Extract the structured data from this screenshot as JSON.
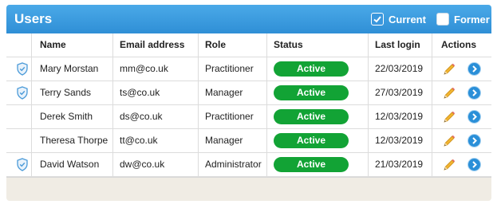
{
  "header": {
    "title": "Users",
    "filters": [
      {
        "label": "Current",
        "checked": true
      },
      {
        "label": "Former",
        "checked": false
      }
    ]
  },
  "columns": [
    "Name",
    "Email address",
    "Role",
    "Status",
    "Last login",
    "Actions"
  ],
  "rows": [
    {
      "shield": true,
      "name": "Mary Morstan",
      "email": "mm@co.uk",
      "role": "Practitioner",
      "status": "Active",
      "last_login": "22/03/2019"
    },
    {
      "shield": true,
      "name": "Terry Sands",
      "email": "ts@co.uk",
      "role": "Manager",
      "status": "Active",
      "last_login": "27/03/2019"
    },
    {
      "shield": false,
      "name": "Derek Smith",
      "email": "ds@co.uk",
      "role": "Practitioner",
      "status": "Active",
      "last_login": "12/03/2019"
    },
    {
      "shield": false,
      "name": "Theresa Thorpe",
      "email": "tt@co.uk",
      "role": "Manager",
      "status": "Active",
      "last_login": "12/03/2019"
    },
    {
      "shield": true,
      "name": "David Watson",
      "email": "dw@co.uk",
      "role": "Administrator",
      "status": "Active",
      "last_login": "21/03/2019"
    }
  ],
  "icons": {
    "shield": "shield-icon",
    "edit": "pencil-icon",
    "open": "arrow-right-circle-icon"
  },
  "colors": {
    "header": "#3a9be0",
    "status_active": "#12a335",
    "action_blue": "#2a8fd8"
  }
}
